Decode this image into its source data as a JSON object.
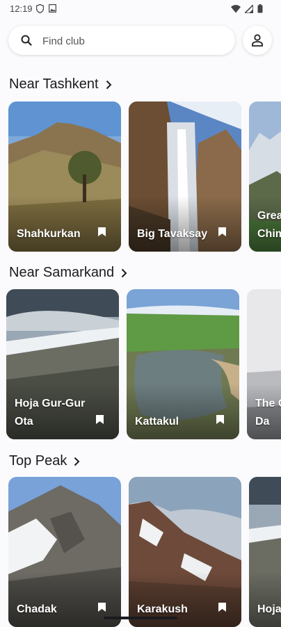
{
  "status_bar": {
    "time": "12:19"
  },
  "search": {
    "placeholder": "Find club"
  },
  "sections": [
    {
      "title": "Near Tashkent",
      "cards": [
        {
          "label": "Shahkurkan",
          "image": "hill-with-tree"
        },
        {
          "label": "Big Tavaksay",
          "image": "waterfall"
        },
        {
          "label": "Great Chimgan",
          "image": "snowy-mountains"
        }
      ]
    },
    {
      "title": "Near Samarkand",
      "cards": [
        {
          "label": "Hoja Gur-Gur Ota",
          "image": "cliff-ridge"
        },
        {
          "label": "Kattakul",
          "image": "mountain-lake"
        },
        {
          "label": "The Gorge of Da",
          "image": "fog"
        }
      ]
    },
    {
      "title": "Top Peak",
      "cards": [
        {
          "label": "Chadak",
          "image": "rocky-peak"
        },
        {
          "label": "Karakush",
          "image": "snowy-slope"
        },
        {
          "label": "Hoja Gur",
          "image": "cliff-ridge"
        }
      ]
    }
  ],
  "icons": {
    "search": "search-icon",
    "profile": "person-icon",
    "bookmark": "bookmark-icon",
    "chevron": "chevron-right-icon"
  }
}
